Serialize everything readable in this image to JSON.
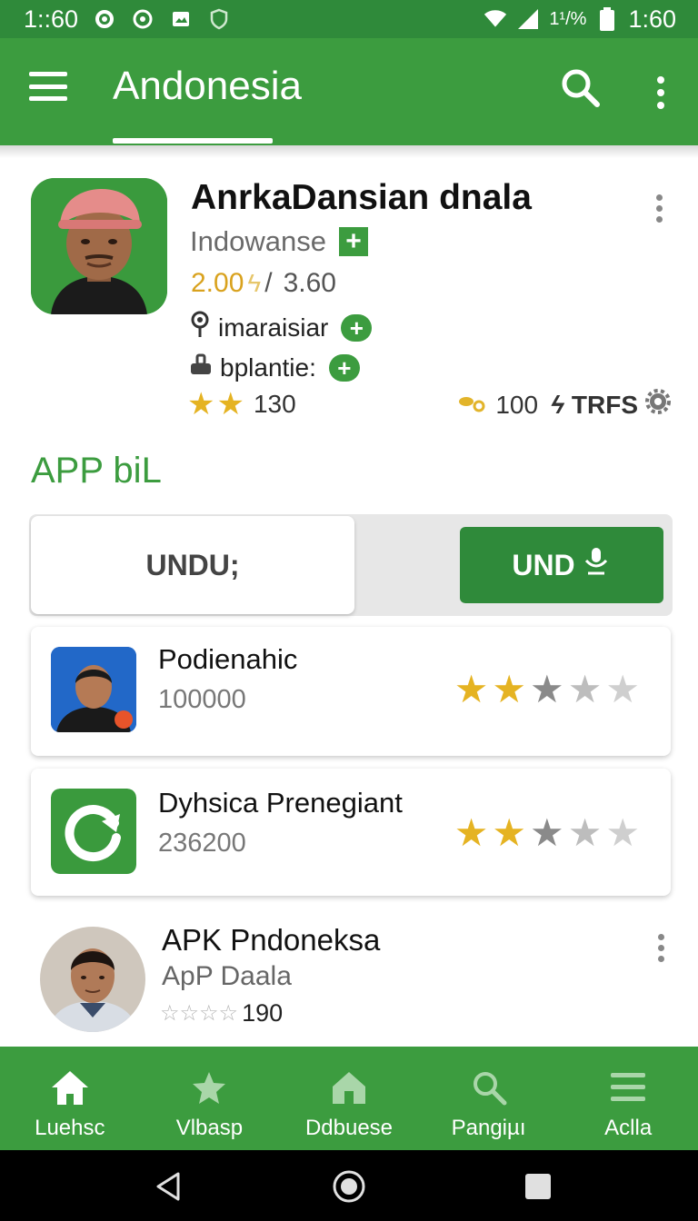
{
  "status_bar": {
    "time_left": "1::60",
    "battery_text": "1¹/%",
    "time_right": "1:60"
  },
  "app_bar": {
    "title": "Andonesia",
    "icons": [
      "menu-icon",
      "search-icon",
      "more-vert-icon"
    ]
  },
  "featured": {
    "title": "AnrkaDansian dnala",
    "subtitle": "Indowanse",
    "price_main": "2.00",
    "price_sep": "/",
    "price_alt": "3.60",
    "location": "imaraisiar",
    "platform": "bplantie:",
    "rating_count": "130",
    "downloads": "100",
    "tag": "TRFS",
    "stars_filled": 2
  },
  "section": {
    "title": "APP biL"
  },
  "toggle": {
    "left_label": "UNDU;",
    "right_label": "UND"
  },
  "list": [
    {
      "name": "Podienahic",
      "count": "100000",
      "stars": [
        1,
        1,
        0.5,
        0.3,
        0.1
      ]
    },
    {
      "name": "Dyhsica Prenegiant",
      "count": "236200",
      "stars": [
        1,
        1,
        0.5,
        0.3,
        0.1
      ]
    }
  ],
  "plain_item": {
    "name": "APK Pndoneksa",
    "subtitle": "ApP Daala",
    "rating_count": "190"
  },
  "bottom_nav": [
    {
      "label": "Luehsc",
      "icon": "home-icon"
    },
    {
      "label": "Vlbasp",
      "icon": "star-icon"
    },
    {
      "label": "Ddbuese",
      "icon": "house-icon"
    },
    {
      "label": "Pangiµı",
      "icon": "search-icon"
    },
    {
      "label": "Aclla",
      "icon": "list-icon"
    }
  ],
  "colors": {
    "primary": "#3c9c3f",
    "primary_dark": "#2f8a3a",
    "star": "#e5b322"
  }
}
